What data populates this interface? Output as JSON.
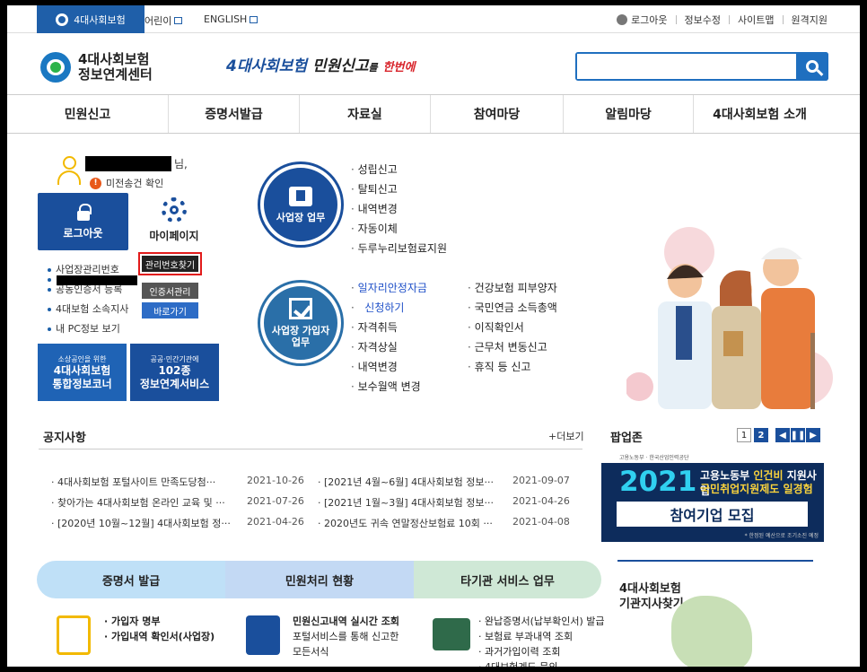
{
  "topbar": {
    "brand_tab": "4대사회보험",
    "kids": "어린이",
    "english": "ENGLISH",
    "logout": "로그아웃",
    "edit_info": "정보수정",
    "sitemap": "사이트맵",
    "remote": "원격지원"
  },
  "header": {
    "logo_line1": "4대사회보험",
    "logo_line2": "정보연계센터",
    "slogan_blue": "4대사회보험",
    "slogan_dark": "민원신고",
    "slogan_small": "를",
    "slogan_red": "한번에",
    "search_placeholder": ""
  },
  "gnb": [
    "민원신고",
    "증명서발급",
    "자료실",
    "참여마당",
    "알림마당",
    "4대사회보험 소개"
  ],
  "user": {
    "suffix": "님,",
    "unsent": "미전송건 확인",
    "logout_label": "로그아웃",
    "mypage_label": "마이페이지"
  },
  "quick_links": [
    "사업장관리번호",
    "공동인증서 등록",
    "4대보험 소속지사",
    "내 PC정보 보기"
  ],
  "quick_buttons": [
    "관리번호찾기",
    "인증서관리",
    "바로가기"
  ],
  "banners": [
    {
      "small": "소상공인을 위한",
      "line1": "4대사회보험",
      "line2": "통합정보코너",
      "color": "#1f63b5"
    },
    {
      "small": "공공·민간기관에",
      "line1": "102종",
      "line2": "정보연계서비스",
      "color": "#1a4f9c"
    }
  ],
  "services": {
    "workplace_label": [
      "사업장 업무"
    ],
    "workplace_items": [
      "성립신고",
      "탈퇴신고",
      "내역변경",
      "자동이체",
      "두루누리보험료지원"
    ],
    "member_label": [
      "사업장 가입자",
      "업무"
    ],
    "member_col1": [
      "일자리안정자금",
      "신청하기",
      "자격취득",
      "자격상실",
      "내역변경",
      "보수월액 변경"
    ],
    "member_col2": [
      "건강보험 피부양자",
      "국민연금 소득총액",
      "이직확인서",
      "근무처 변동신고",
      "휴직 등 신고"
    ]
  },
  "notices": {
    "title": "공지사항",
    "more": "+더보기",
    "left": [
      {
        "title": "4대사회보험 포털사이트 만족도당첨···",
        "date": "2021-10-26"
      },
      {
        "title": "찾아가는 4대사회보험 온라인 교육 및 ···",
        "date": "2021-07-26"
      },
      {
        "title": "[2020년 10월~12월] 4대사회보험 정···",
        "date": "2021-04-26"
      }
    ],
    "right": [
      {
        "title": "[2021년 4월~6월] 4대사회보험 정보···",
        "date": "2021-09-07"
      },
      {
        "title": "[2021년 1월~3월] 4대사회보험 정보···",
        "date": "2021-04-26"
      },
      {
        "title": "2020년도 귀속 연말정산보험료 10회 ···",
        "date": "2021-04-08"
      }
    ]
  },
  "popup_zone": {
    "title": "팝업존",
    "pages": [
      "1",
      "2"
    ],
    "banner_top": "고용노동부 · 한국산업인력공단",
    "banner_year": "2021",
    "banner_line1a": "고용노동부 ",
    "banner_line1b": "인건비",
    "banner_line1c": " 지원사업",
    "banner_line2": "국민취업지원제도 일경험",
    "banner_bar": "참여기업 모집",
    "banner_foot": "* 한정된 예산으로 조기소진 예정"
  },
  "bottom_tabs": {
    "tabs": [
      {
        "label": "증명서 발급",
        "color": "#bfe0f7"
      },
      {
        "label": "민원처리 현황",
        "color": "#c3d9f4"
      },
      {
        "label": "타기관 서비스 업무",
        "color": "#cfe8d6"
      }
    ],
    "col1": [
      "가입자 명부",
      "가입내역 확인서(사업장)"
    ],
    "col2_title": "민원신고내역 실시간 조회",
    "col2_desc1": "포털서비스를 통해 신고한",
    "col2_desc2": "모든서식",
    "col3": [
      "완납증명서(납부확인서) 발급",
      "보험료 부과내역 조회",
      "과거가입이력 조회",
      "4대보험계도 문의"
    ]
  },
  "branch": {
    "line1": "4대사회보험",
    "line2": "기관지사찾기"
  },
  "colors": {
    "primary": "#1a4f9c",
    "accent": "#1f6fbf",
    "alert": "#e21b1b"
  }
}
